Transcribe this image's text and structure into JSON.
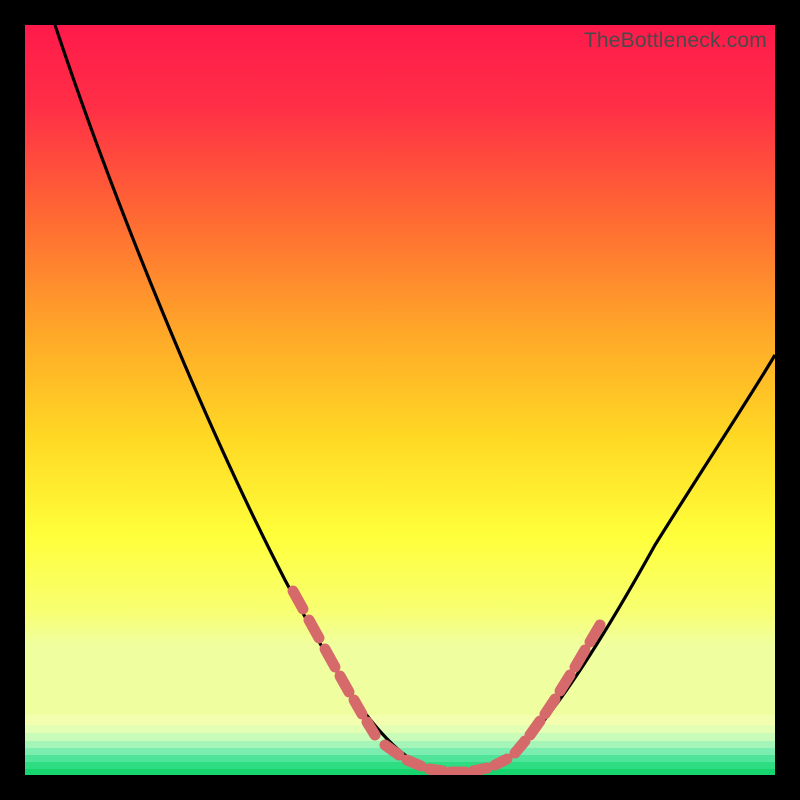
{
  "watermark": "TheBottleneck.com",
  "colors": {
    "background": "#000000",
    "gradient_top": "#ff1a4b",
    "gradient_mid_upper": "#ff7a2e",
    "gradient_mid": "#ffcf2a",
    "gradient_mid_lower": "#ffff3d",
    "gradient_low": "#f5ff7a",
    "gradient_bottom_band_1": "#d8ffb0",
    "gradient_bottom_band_2": "#8cf2b8",
    "gradient_bottom_band_3": "#26e07a",
    "gradient_bottom_band_4": "#12d86a",
    "curve": "#000000",
    "bead": "#d86a6a",
    "watermark": "#4a4a4a"
  },
  "chart_data": {
    "type": "line",
    "title": "",
    "xlabel": "",
    "ylabel": "",
    "xlim": [
      0,
      100
    ],
    "ylim": [
      0,
      100
    ],
    "comment": "V-shaped bottleneck curve. Values are percentage of plot height (0=top, 100=bottom) against percentage of plot width. Read from the image gridless — approximated.",
    "x": [
      4,
      8,
      12,
      16,
      20,
      24,
      28,
      32,
      36,
      40,
      44,
      46,
      48,
      50,
      52,
      54,
      56,
      58,
      60,
      62,
      64,
      66,
      70,
      74,
      78,
      82,
      86,
      90,
      94,
      98,
      100
    ],
    "y_from_top_pct": [
      0,
      9,
      18,
      27,
      35,
      43,
      51,
      59,
      66,
      73,
      79,
      82,
      85,
      90,
      94,
      96,
      97,
      97,
      97,
      96,
      94,
      91,
      84,
      77,
      71,
      65,
      59,
      54,
      49,
      45,
      43
    ],
    "bead_segments": [
      {
        "side": "left",
        "x_start_pct": 37,
        "x_end_pct": 43,
        "count": 6
      },
      {
        "side": "floor",
        "x_start_pct": 47,
        "x_end_pct": 63,
        "count": 9
      },
      {
        "side": "right",
        "x_start_pct": 64,
        "x_end_pct": 72,
        "count": 6
      }
    ],
    "notes": "Background is a vertical heat gradient from red (high bottleneck) at top to thin green bands (low/no bottleneck) at bottom."
  }
}
